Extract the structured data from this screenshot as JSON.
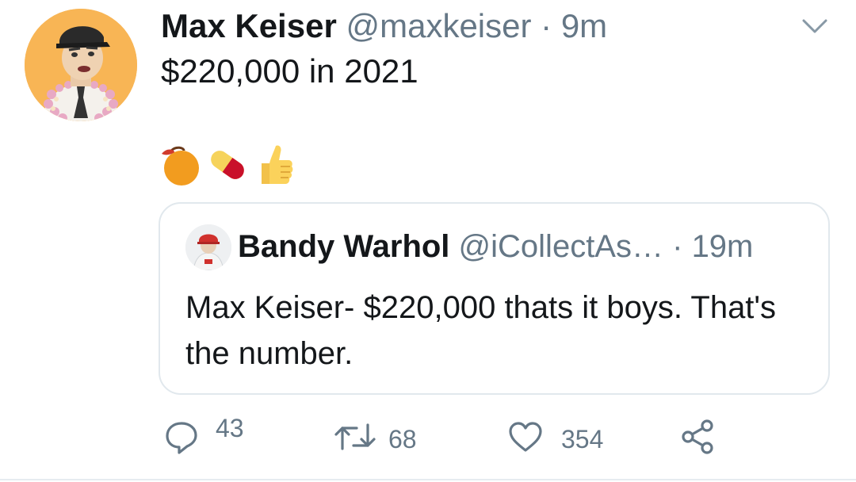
{
  "tweet": {
    "author_name": "Max Keiser",
    "author_handle": "@maxkeiser",
    "separator": "·",
    "time": "9m",
    "text": "$220,000 in 2021",
    "emojis": [
      "orange-emoji",
      "pill-emoji",
      "thumbs-up-emoji"
    ]
  },
  "quote": {
    "author_name": "Bandy Warhol",
    "author_handle": "@iCollectAs…",
    "separator": "·",
    "time": "19m",
    "text": "Max Keiser- $220,000 thats it boys. That's the number."
  },
  "actions": {
    "reply_count": "43",
    "retweet_count": "68",
    "like_count": "354"
  },
  "colors": {
    "text_primary": "#14171a",
    "text_secondary": "#657786",
    "border": "#e1e8ed",
    "avatar_bg": "#f8b555"
  }
}
